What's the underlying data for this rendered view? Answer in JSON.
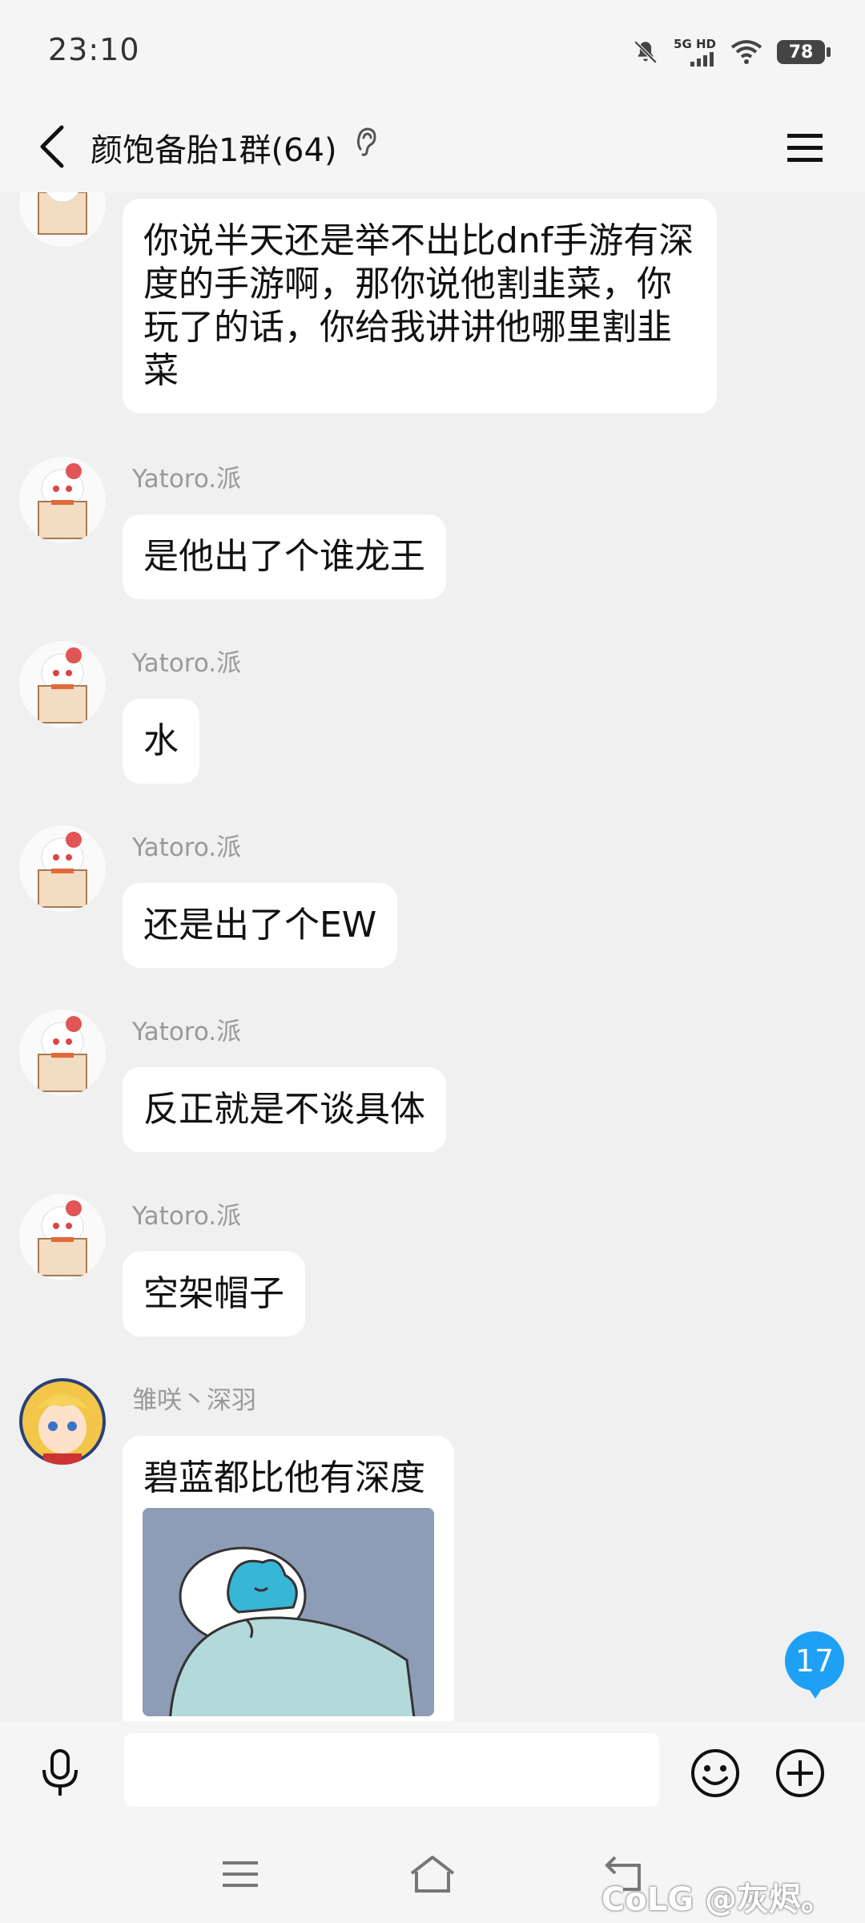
{
  "status_bar": {
    "time": "23:10",
    "network_label": "5G HD",
    "battery": "78",
    "icons": [
      "mute-icon",
      "signal-icon",
      "wifi-icon",
      "battery-icon"
    ]
  },
  "header": {
    "title": "颜饱备胎1群(64)",
    "icons": [
      "back-arrow-icon",
      "ear-icon",
      "menu-icon"
    ]
  },
  "messages": [
    {
      "sender": "",
      "text": "你说半天还是举不出比dnf手游有深度的手游啊，那你说他割韭菜，你玩了的话，你给我讲讲他哪里割韭菜"
    },
    {
      "sender": "Yatoro.派",
      "text": "是他出了个谁龙王"
    },
    {
      "sender": "Yatoro.派",
      "text": "水"
    },
    {
      "sender": "Yatoro.派",
      "text": "还是出了个EW"
    },
    {
      "sender": "Yatoro.派",
      "text": "反正就是不谈具体"
    },
    {
      "sender": "Yatoro.派",
      "text": "空架帽子"
    },
    {
      "sender": "雏咲丶深羽",
      "text": "碧蓝都比他有深度",
      "has_image": true
    }
  ],
  "unread_badge": "17",
  "input": {
    "value": "",
    "placeholder": "",
    "icons": [
      "microphone-icon",
      "emoji-icon",
      "plus-icon"
    ]
  },
  "nav_bar": {
    "icons": [
      "menu-lines-icon",
      "home-icon",
      "back-icon"
    ]
  },
  "watermark": "CoLG @灰烬。",
  "colors": {
    "accent": "#1ea0f5",
    "bubble": "#ffffff",
    "background": "#f0f0f0"
  }
}
